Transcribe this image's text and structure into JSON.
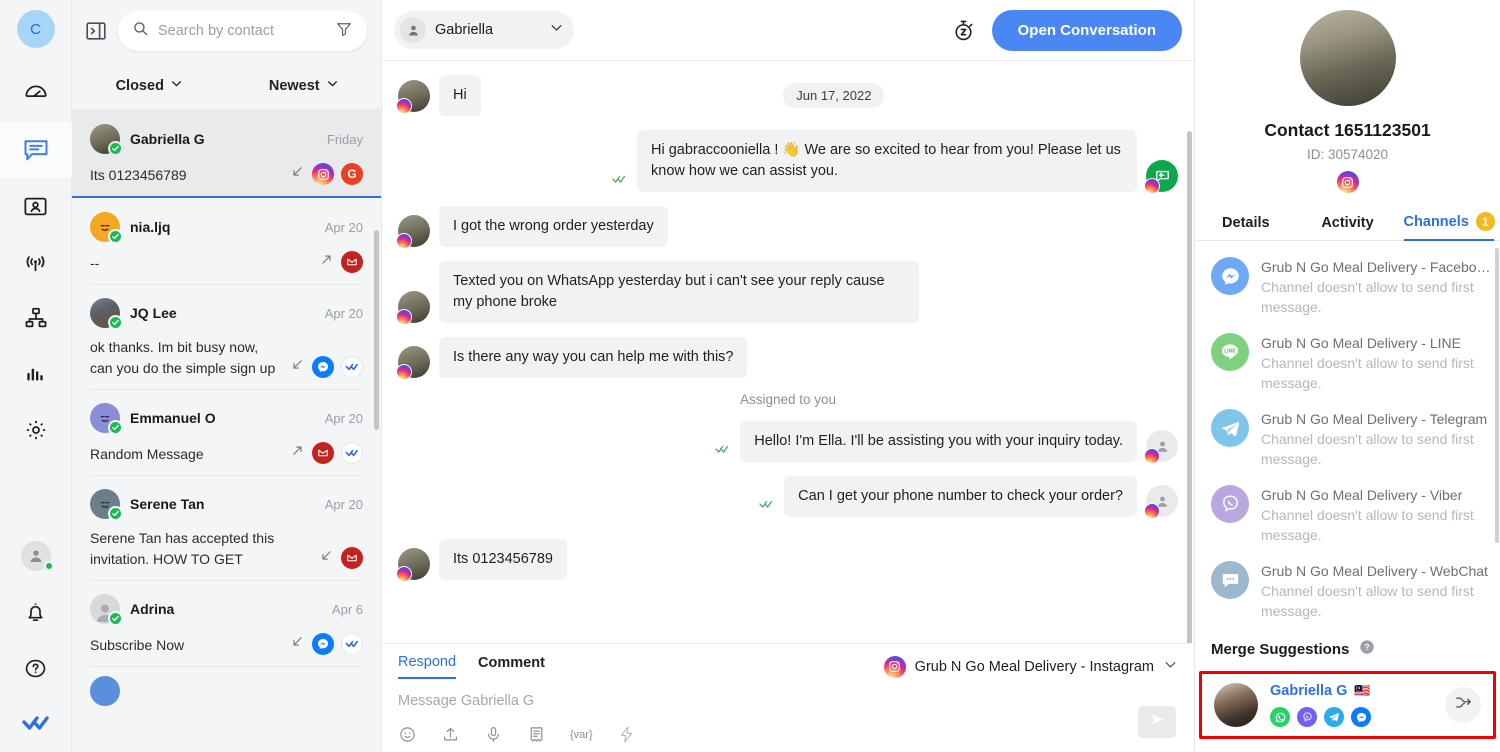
{
  "rail": {
    "workspace_initial": "C",
    "items": [
      {
        "name": "dashboard",
        "icon": "speedometer-icon"
      },
      {
        "name": "inbox",
        "icon": "chat-bubble-icon",
        "active": true
      },
      {
        "name": "contacts",
        "icon": "contact-card-icon"
      },
      {
        "name": "broadcast",
        "icon": "broadcast-icon"
      },
      {
        "name": "flow-builder",
        "icon": "sitemap-icon"
      },
      {
        "name": "reports",
        "icon": "bar-chart-icon"
      },
      {
        "name": "settings",
        "icon": "gear-icon"
      }
    ],
    "bottom_items": [
      {
        "name": "profile",
        "icon": "user-avatar-icon"
      },
      {
        "name": "notifications",
        "icon": "bell-icon"
      },
      {
        "name": "help",
        "icon": "question-circle-icon"
      },
      {
        "name": "brand",
        "icon": "double-check-logo-icon"
      }
    ]
  },
  "sidebar": {
    "panel_toggle_icon": "panel-collapse-icon",
    "search": {
      "placeholder": "Search by contact",
      "icon": "search-icon",
      "filter_icon": "filter-funnel-icon"
    },
    "filters": [
      {
        "label": "Closed",
        "icon": "chevron-down-icon"
      },
      {
        "label": "Newest",
        "icon": "chevron-down-icon"
      }
    ],
    "conversations": [
      {
        "name": "Gabriella G",
        "time": "Friday",
        "preview": "Its 0123456789",
        "selected": true,
        "direction": "incoming",
        "badges": [
          "instagram",
          "gmail-g"
        ],
        "avatar_kind": "photo-dark",
        "status": "verified"
      },
      {
        "name": "nia.ljq",
        "time": "Apr 20",
        "preview": "--",
        "selected": false,
        "direction": "outgoing",
        "badges": [
          "gmail"
        ],
        "avatar_kind": "emoji-orange",
        "status": "verified"
      },
      {
        "name": "JQ Lee",
        "time": "Apr 20",
        "preview": "ok thanks. Im bit busy now, can you do the simple sign up for me…",
        "selected": false,
        "direction": "incoming",
        "badges": [
          "messenger",
          "double-check"
        ],
        "avatar_kind": "photo-woman",
        "status": "verified"
      },
      {
        "name": "Emmanuel O",
        "time": "Apr 20",
        "preview": "Random Message",
        "selected": false,
        "direction": "outgoing",
        "badges": [
          "gmail",
          "double-check"
        ],
        "avatar_kind": "emoji-purple",
        "status": "verified"
      },
      {
        "name": "Serene Tan",
        "time": "Apr 20",
        "preview": "Serene Tan has accepted this invitation. HOW TO GET WHATSAPP…",
        "selected": false,
        "direction": "incoming",
        "badges": [
          "gmail"
        ],
        "avatar_kind": "emoji-slate",
        "status": "verified"
      },
      {
        "name": "Adrina",
        "time": "Apr 6",
        "preview": "Subscribe Now",
        "selected": false,
        "direction": "incoming",
        "badges": [
          "messenger",
          "double-check"
        ],
        "avatar_kind": "generic-person",
        "status": "verified"
      }
    ]
  },
  "chat": {
    "assignee": {
      "label": "Gabriella",
      "icon": "person-icon",
      "chevron": "chevron-down-icon"
    },
    "timer_icon": "snooze-timer-icon",
    "open_conversation_label": "Open Conversation",
    "date_divider": "Jun 17, 2022",
    "system_note": "Assigned to you",
    "messages": [
      {
        "dir": "in",
        "text": "Hi",
        "channel": "instagram"
      },
      {
        "dir": "out",
        "text": "Hi gabraccooniella ! 👋 We are so excited to hear from you! Please let us know how we can assist you.",
        "channel": "instagram",
        "status": "read",
        "sender": "bot-green"
      },
      {
        "dir": "in",
        "text": "I got the wrong order yesterday",
        "channel": "instagram"
      },
      {
        "dir": "in",
        "text": "Texted you on WhatsApp yesterday but i can't see your reply cause my phone broke",
        "channel": "instagram"
      },
      {
        "dir": "in",
        "text": "Is there any way you can help me with this?",
        "channel": "instagram"
      },
      {
        "dir": "out",
        "text": "Hello! I'm Ella. I'll be assisting you with your inquiry today.",
        "channel": "instagram",
        "status": "read",
        "sender": "agent"
      },
      {
        "dir": "out",
        "text": "Can I get your phone number to check your order?",
        "channel": "instagram",
        "status": "read",
        "sender": "agent"
      },
      {
        "dir": "in",
        "text": "Its 0123456789",
        "channel": "instagram"
      }
    ],
    "composer": {
      "tabs": [
        {
          "label": "Respond",
          "active": true
        },
        {
          "label": "Comment",
          "active": false
        }
      ],
      "channel_selector": {
        "label": "Grub N Go Meal Delivery - Instagram",
        "icon": "instagram-icon",
        "chevron": "chevron-down-icon"
      },
      "placeholder": "Message Gabriella G",
      "tools": [
        {
          "name": "emoji-icon"
        },
        {
          "name": "upload-icon"
        },
        {
          "name": "microphone-icon"
        },
        {
          "name": "template-icon"
        },
        {
          "name": "variable-icon",
          "label": "{var}"
        },
        {
          "name": "quick-reply-lightning-icon"
        }
      ],
      "send_icon": "send-icon"
    }
  },
  "right_panel": {
    "contact_name": "Contact 1651123501",
    "contact_id": "ID: 30574020",
    "contact_channel_icon": "instagram-icon",
    "tabs": [
      {
        "label": "Details",
        "active": false
      },
      {
        "label": "Activity",
        "active": false
      },
      {
        "label": "Channels",
        "active": true,
        "badge": "1"
      }
    ],
    "channels": [
      {
        "title": "Grub N Go Meal Delivery - Facebo…",
        "subtitle": "Channel doesn't allow to send first message.",
        "icon": "messenger-icon"
      },
      {
        "title": "Grub N Go Meal Delivery - LINE",
        "subtitle": "Channel doesn't allow to send first message.",
        "icon": "line-icon"
      },
      {
        "title": "Grub N Go Meal Delivery - Telegram",
        "subtitle": "Channel doesn't allow to send first message.",
        "icon": "telegram-icon"
      },
      {
        "title": "Grub N Go Meal Delivery - Viber",
        "subtitle": "Channel doesn't allow to send first message.",
        "icon": "viber-icon"
      },
      {
        "title": "Grub N Go Meal Delivery - WebChat",
        "subtitle": "Channel doesn't allow to send first message.",
        "icon": "webchat-icon"
      }
    ],
    "merge": {
      "heading": "Merge Suggestions",
      "help_icon": "help-circle-icon",
      "suggestion": {
        "name": "Gabriella G",
        "flag": "🇲🇾",
        "channels": [
          "whatsapp",
          "viber",
          "telegram",
          "messenger"
        ],
        "action_icon": "merge-arrow-icon"
      }
    }
  },
  "colors": {
    "accent_blue": "#2f6fe4",
    "primary_button": "#4a87f5",
    "highlight_red": "#f20000",
    "badge_yellow": "#f5b820",
    "verified_green": "#1db954"
  }
}
